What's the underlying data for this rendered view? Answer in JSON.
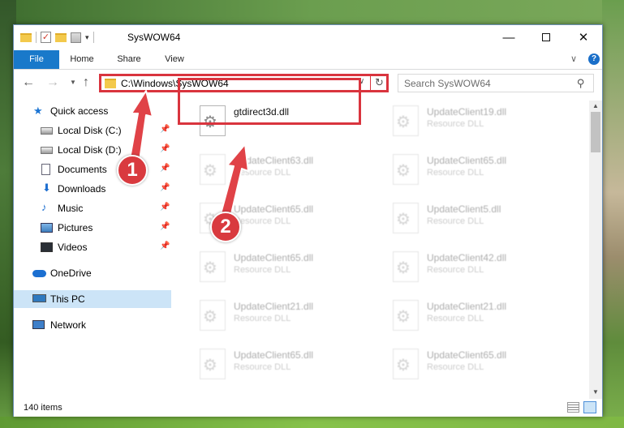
{
  "window": {
    "title": "SysWOW64",
    "controls": {
      "minimize": "—",
      "close": "✕"
    }
  },
  "ribbon": {
    "tabs": [
      "File",
      "Home",
      "Share",
      "View"
    ],
    "help": "?"
  },
  "navigation": {
    "address": "C:\\Windows\\SysWOW64",
    "search_placeholder": "Search SysWOW64"
  },
  "sidebar": {
    "items": [
      {
        "label": "Quick access",
        "icon": "star-icon"
      },
      {
        "label": "Local Disk (C:)",
        "icon": "drive-icon",
        "pinned": true
      },
      {
        "label": "Local Disk (D:)",
        "icon": "drive-icon",
        "pinned": true
      },
      {
        "label": "Documents",
        "icon": "documents-icon",
        "pinned": true
      },
      {
        "label": "Downloads",
        "icon": "download-icon",
        "pinned": true
      },
      {
        "label": "Music",
        "icon": "music-icon",
        "pinned": true
      },
      {
        "label": "Pictures",
        "icon": "pictures-icon",
        "pinned": true
      },
      {
        "label": "Videos",
        "icon": "videos-icon",
        "pinned": true
      },
      {
        "label": "OneDrive",
        "icon": "cloud-icon"
      },
      {
        "label": "This PC",
        "icon": "computer-icon",
        "selected": true
      },
      {
        "label": "Network",
        "icon": "network-icon"
      }
    ]
  },
  "files": [
    {
      "name": "gtdirect3d.dll",
      "type": ""
    },
    {
      "name": "UpdateClient19.dll",
      "type": "Resource DLL"
    },
    {
      "name": "UpdateClient63.dll",
      "type": "Resource DLL"
    },
    {
      "name": "UpdateClient65.dll",
      "type": "Resource DLL"
    },
    {
      "name": "UpdateClient65.dll",
      "type": "Resource DLL"
    },
    {
      "name": "UpdateClient5.dll",
      "type": "Resource DLL"
    },
    {
      "name": "UpdateClient65.dll",
      "type": "Resource DLL"
    },
    {
      "name": "UpdateClient42.dll",
      "type": "Resource DLL"
    },
    {
      "name": "UpdateClient21.dll",
      "type": "Resource DLL"
    },
    {
      "name": "UpdateClient21.dll",
      "type": "Resource DLL"
    },
    {
      "name": "UpdateClient65.dll",
      "type": "Resource DLL"
    },
    {
      "name": "UpdateClient65.dll",
      "type": "Resource DLL"
    }
  ],
  "status": {
    "item_count": "140 items"
  },
  "annotations": {
    "marker_1": "1",
    "marker_2": "2"
  },
  "colors": {
    "accent": "#1979ca",
    "highlight": "#d9343e",
    "selection": "#cce4f7"
  }
}
